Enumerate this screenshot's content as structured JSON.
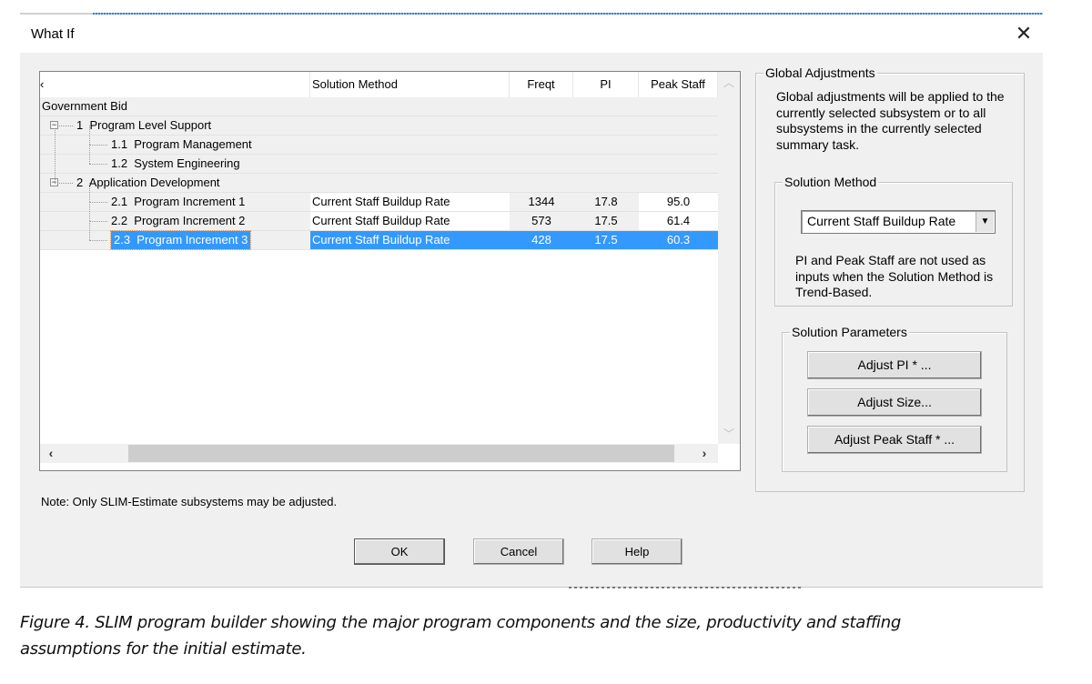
{
  "window": {
    "title": "What If",
    "close_icon": "close-x-icon"
  },
  "grid": {
    "columns": [
      {
        "key": "name",
        "label": "‹"
      },
      {
        "key": "method",
        "label": "Solution Method"
      },
      {
        "key": "freqt",
        "label": "Freqt"
      },
      {
        "key": "pi",
        "label": "PI"
      },
      {
        "key": "peak",
        "label": "Peak Staff"
      }
    ],
    "rows": [
      {
        "id": "",
        "name": "Government Bid",
        "level": 0,
        "expander": "",
        "method": "",
        "freqt": "",
        "pi": "",
        "peak": "",
        "selected": false
      },
      {
        "id": "1",
        "name": "Program Level Support",
        "level": 1,
        "expander": "−",
        "method": "",
        "freqt": "",
        "pi": "",
        "peak": "",
        "selected": false
      },
      {
        "id": "1.1",
        "name": "Program Management",
        "level": 2,
        "expander": "",
        "method": "",
        "freqt": "",
        "pi": "",
        "peak": "",
        "selected": false
      },
      {
        "id": "1.2",
        "name": "System Engineering",
        "level": 2,
        "expander": "",
        "method": "",
        "freqt": "",
        "pi": "",
        "peak": "",
        "selected": false
      },
      {
        "id": "2",
        "name": "Application Development",
        "level": 1,
        "expander": "−",
        "method": "",
        "freqt": "",
        "pi": "",
        "peak": "",
        "selected": false
      },
      {
        "id": "2.1",
        "name": "Program Increment 1",
        "level": 2,
        "expander": "",
        "method": "Current Staff Buildup Rate",
        "freqt": "1344",
        "pi": "17.8",
        "peak": "95.0",
        "selected": false
      },
      {
        "id": "2.2",
        "name": "Program Increment 2",
        "level": 2,
        "expander": "",
        "method": "Current Staff Buildup Rate",
        "freqt": "573",
        "pi": "17.5",
        "peak": "61.4",
        "selected": false
      },
      {
        "id": "2.3",
        "name": "Program Increment 3",
        "level": 2,
        "expander": "",
        "method": "Current Staff Buildup Rate",
        "freqt": "428",
        "pi": "17.5",
        "peak": "60.3",
        "selected": true
      }
    ],
    "scroll_up_icon": "chevron-up-icon",
    "scroll_down_icon": "chevron-down-icon",
    "scroll_left_icon": "chevron-left-icon",
    "scroll_right_icon": "chevron-right-icon"
  },
  "note": "Note: Only SLIM-Estimate subsystems may be adjusted.",
  "global_adjustments": {
    "legend": "Global Adjustments",
    "description": "Global adjustments will be applied to the currently selected subsystem or to all subsystems in the currently selected summary task.",
    "solution_method": {
      "legend": "Solution Method",
      "selected": "Current Staff Buildup Rate",
      "hint": "PI and Peak Staff are not used as inputs when the Solution Method is Trend-Based."
    },
    "solution_parameters": {
      "legend": "Solution Parameters",
      "buttons": [
        "Adjust PI * ...",
        "Adjust Size...",
        "Adjust Peak Staff * ..."
      ]
    }
  },
  "footer": {
    "ok": "OK",
    "cancel": "Cancel",
    "help": "Help"
  },
  "caption": {
    "line1": "Figure 4.  SLIM program builder showing the major program components and the size, productivity and staffing",
    "line2": "assumptions for the initial estimate."
  }
}
